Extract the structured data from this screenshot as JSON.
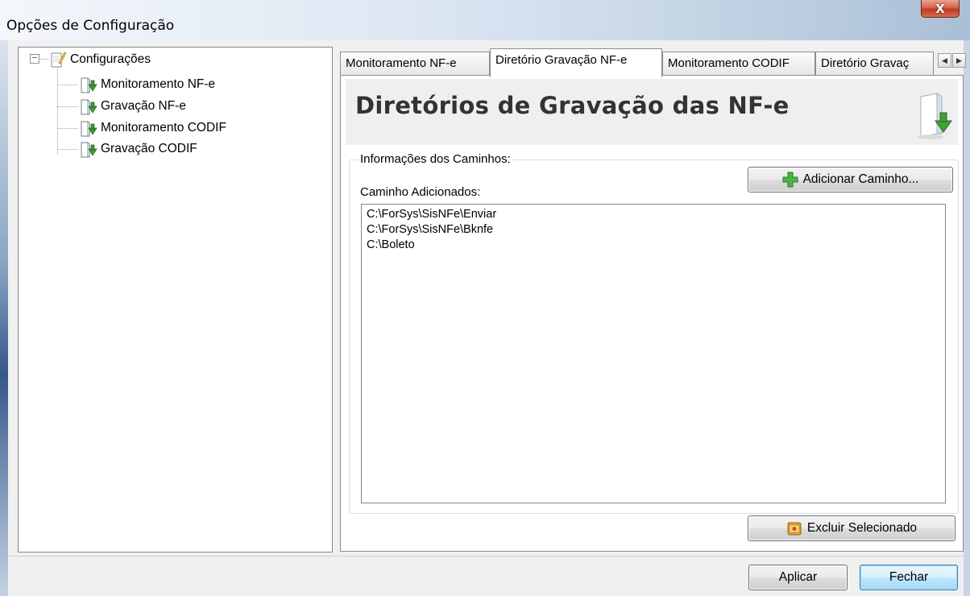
{
  "window": {
    "title": "Opções de Configuração",
    "close_label": "X"
  },
  "tree": {
    "root": {
      "label": "Configurações",
      "icon": "note-pencil-icon",
      "expander": "−"
    },
    "children": [
      {
        "label": "Monitoramento NF-e",
        "icon": "folder-download-icon"
      },
      {
        "label": "Gravação NF-e",
        "icon": "folder-download-icon"
      },
      {
        "label": "Monitoramento CODIF",
        "icon": "folder-download-icon"
      },
      {
        "label": "Gravação CODIF",
        "icon": "folder-download-icon"
      }
    ]
  },
  "tabs": {
    "items": [
      {
        "label": "Monitoramento NF-e"
      },
      {
        "label": "Diretório Gravação NF-e"
      },
      {
        "label": "Monitoramento CODIF"
      },
      {
        "label": "Diretório Gravaç"
      }
    ],
    "active": 1,
    "scroll_left": "◀",
    "scroll_right": "▶"
  },
  "page": {
    "heading": "Diretórios de Gravação das NF-e",
    "group_label": "Informações dos Caminhos:",
    "add_button": "Adicionar Caminho...",
    "list_label": "Caminho Adicionados:",
    "paths": [
      "C:\\ForSys\\SisNFe\\Enviar",
      "C:\\ForSys\\SisNFe\\Bknfe",
      "C:\\Boleto"
    ],
    "delete_button": "Excluir Selecionado"
  },
  "footer": {
    "apply_button": "Aplicar",
    "close_button": "Fechar"
  }
}
